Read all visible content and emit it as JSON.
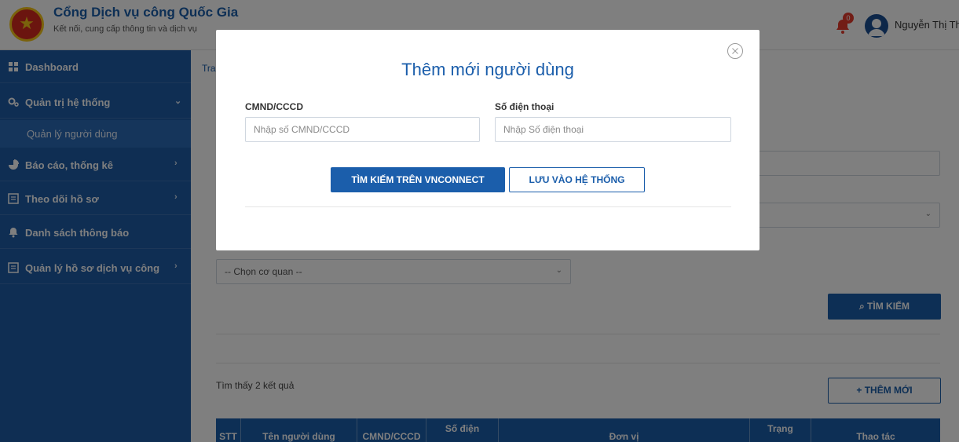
{
  "header": {
    "title": "Cổng Dịch vụ công Quốc Gia",
    "subtitle": "Kết nối, cung cấp thông tin và dịch vụ",
    "notification_count": "0",
    "user_name": "Nguyễn Thị Th"
  },
  "sidebar": {
    "items": [
      {
        "label": "Dashboard"
      },
      {
        "label": "Quản trị hệ thống"
      },
      {
        "label": "Quản lý người dùng"
      },
      {
        "label": "Báo cáo, thống kê"
      },
      {
        "label": "Theo dõi hồ sơ"
      },
      {
        "label": "Danh sách thông báo"
      },
      {
        "label": "Quản lý hồ sơ dịch vụ công"
      }
    ]
  },
  "main": {
    "breadcrumb": "Tran",
    "agency_select": "-- Chọn cơ quan --",
    "search_button": "TÌM KIẾM",
    "result_count": "Tìm thấy 2 kết quả",
    "add_button": "+ THÊM MỚI",
    "table_headers": [
      "STT",
      "Tên người dùng",
      "CMND/CCCD",
      "Số điện",
      "Đơn vị",
      "Trạng",
      "Thao tác"
    ]
  },
  "modal": {
    "title": "Thêm mới người dùng",
    "id_label": "CMND/CCCD",
    "id_placeholder": "Nhập số CMND/CCCD",
    "id_value": "",
    "phone_label": "Số điện thoại",
    "phone_placeholder": "Nhập Số điện thoại",
    "phone_value": "",
    "search_vnconnect_button": "TÌM KIẾM TRÊN VNCONNECT",
    "save_button": "LƯU VÀO HỆ THỐNG"
  },
  "colors": {
    "brand_blue": "#1b5eab",
    "sidebar_bg": "#1f5ca7",
    "badge_red": "#e43b2c"
  }
}
